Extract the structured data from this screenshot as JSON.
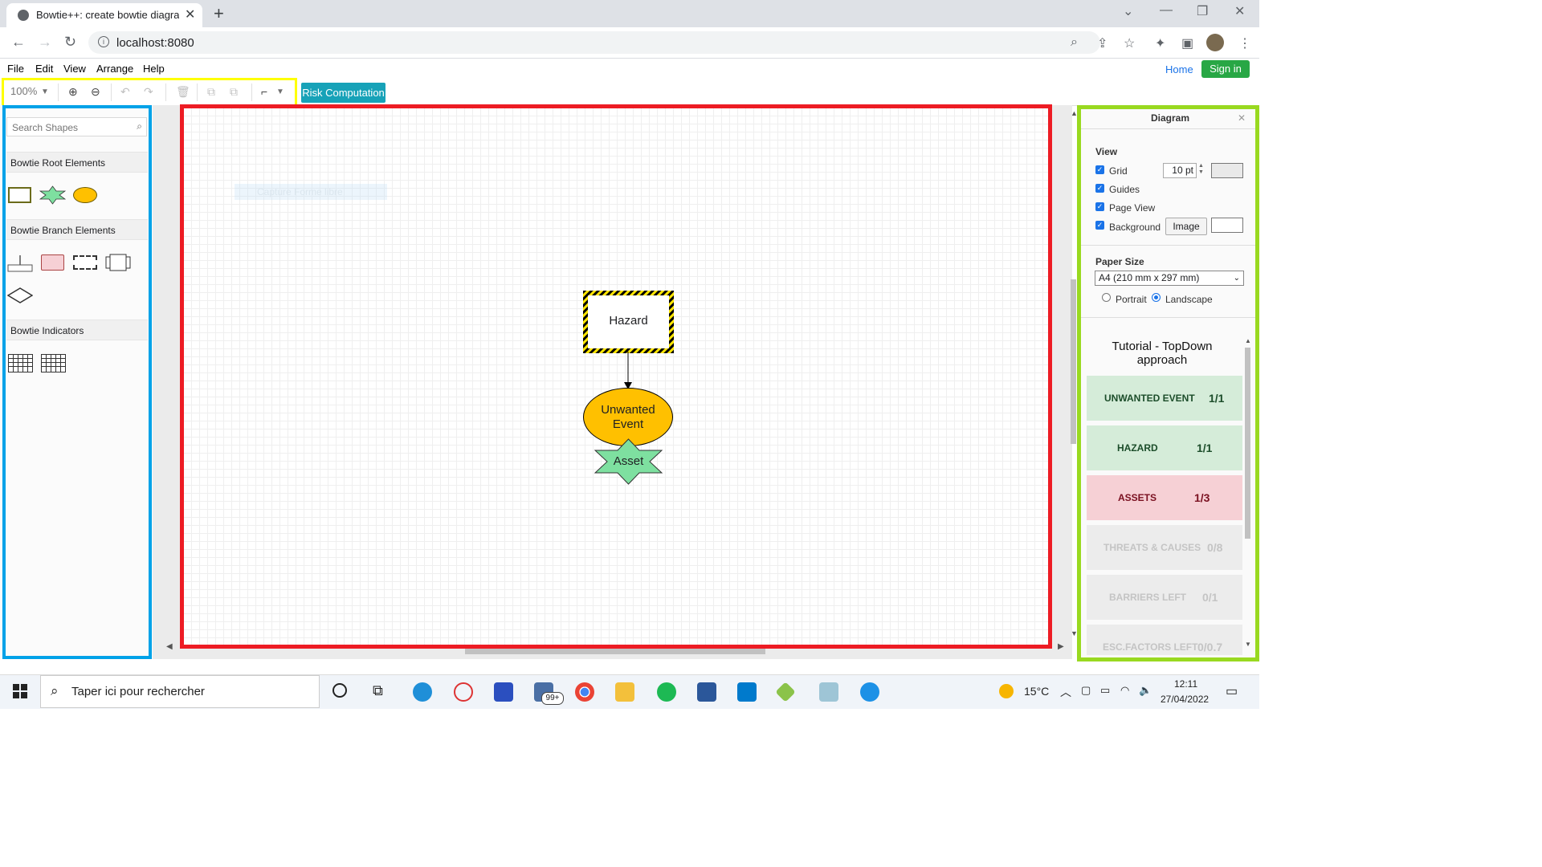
{
  "browser": {
    "tab_title": "Bowtie++: create bowtie diagram",
    "new_tab": "+",
    "url": "localhost:8080"
  },
  "menu": [
    "File",
    "Edit",
    "View",
    "Arrange",
    "Help"
  ],
  "header_links": {
    "home": "Home",
    "sign_in": "Sign in"
  },
  "toolbar": {
    "zoom": "100%",
    "risk_computation": "Risk Computation"
  },
  "sidebar": {
    "search_placeholder": "Search Shapes",
    "categories": [
      {
        "label": "Bowtie Root Elements"
      },
      {
        "label": "Bowtie Branch Elements"
      },
      {
        "label": "Bowtie Indicators"
      }
    ]
  },
  "canvas": {
    "ghost_label": "Capture Forme libre",
    "nodes": {
      "hazard": "Hazard",
      "unwanted_event_line1": "Unwanted",
      "unwanted_event_line2": "Event",
      "asset": "Asset"
    }
  },
  "format_panel": {
    "title": "Diagram",
    "view_heading": "View",
    "grid": "Grid",
    "grid_size": "10 pt",
    "guides": "Guides",
    "page_view": "Page View",
    "background": "Background",
    "image_button": "Image",
    "paper_size_heading": "Paper Size",
    "paper_size": "A4 (210 mm x 297 mm)",
    "portrait": "Portrait",
    "landscape": "Landscape"
  },
  "tutorial": {
    "title_line1": "Tutorial - TopDown",
    "title_line2": "approach",
    "steps": [
      {
        "label": "UNWANTED EVENT",
        "progress": "1/1",
        "state": "done"
      },
      {
        "label": "HAZARD",
        "progress": "1/1",
        "state": "done"
      },
      {
        "label": "ASSETS",
        "progress": "1/3",
        "state": "active"
      },
      {
        "label": "THREATS & CAUSES",
        "progress": "0/8",
        "state": "pending"
      },
      {
        "label": "BARRIERS LEFT",
        "progress": "0/1",
        "state": "pending"
      },
      {
        "label": "ESC.FACTORS LEFT",
        "progress": "0/0.7",
        "state": "pending"
      }
    ]
  },
  "taskbar": {
    "search_placeholder": "Taper ici pour rechercher",
    "mail_badge": "99+",
    "temperature": "15°C",
    "time": "12:11",
    "date": "27/04/2022"
  },
  "colors": {
    "highlight_toolbar": "#ffff00",
    "highlight_sidebar": "#00a2e8",
    "highlight_canvas": "#ed1c24",
    "highlight_panel": "#99d920",
    "risk_button": "#17a2b8",
    "unwanted_event_fill": "#ffc000",
    "asset_fill": "#7ee0a0",
    "card_done": "#d5ecd9",
    "card_active": "#f6d0d5",
    "card_pending": "#ececec"
  }
}
